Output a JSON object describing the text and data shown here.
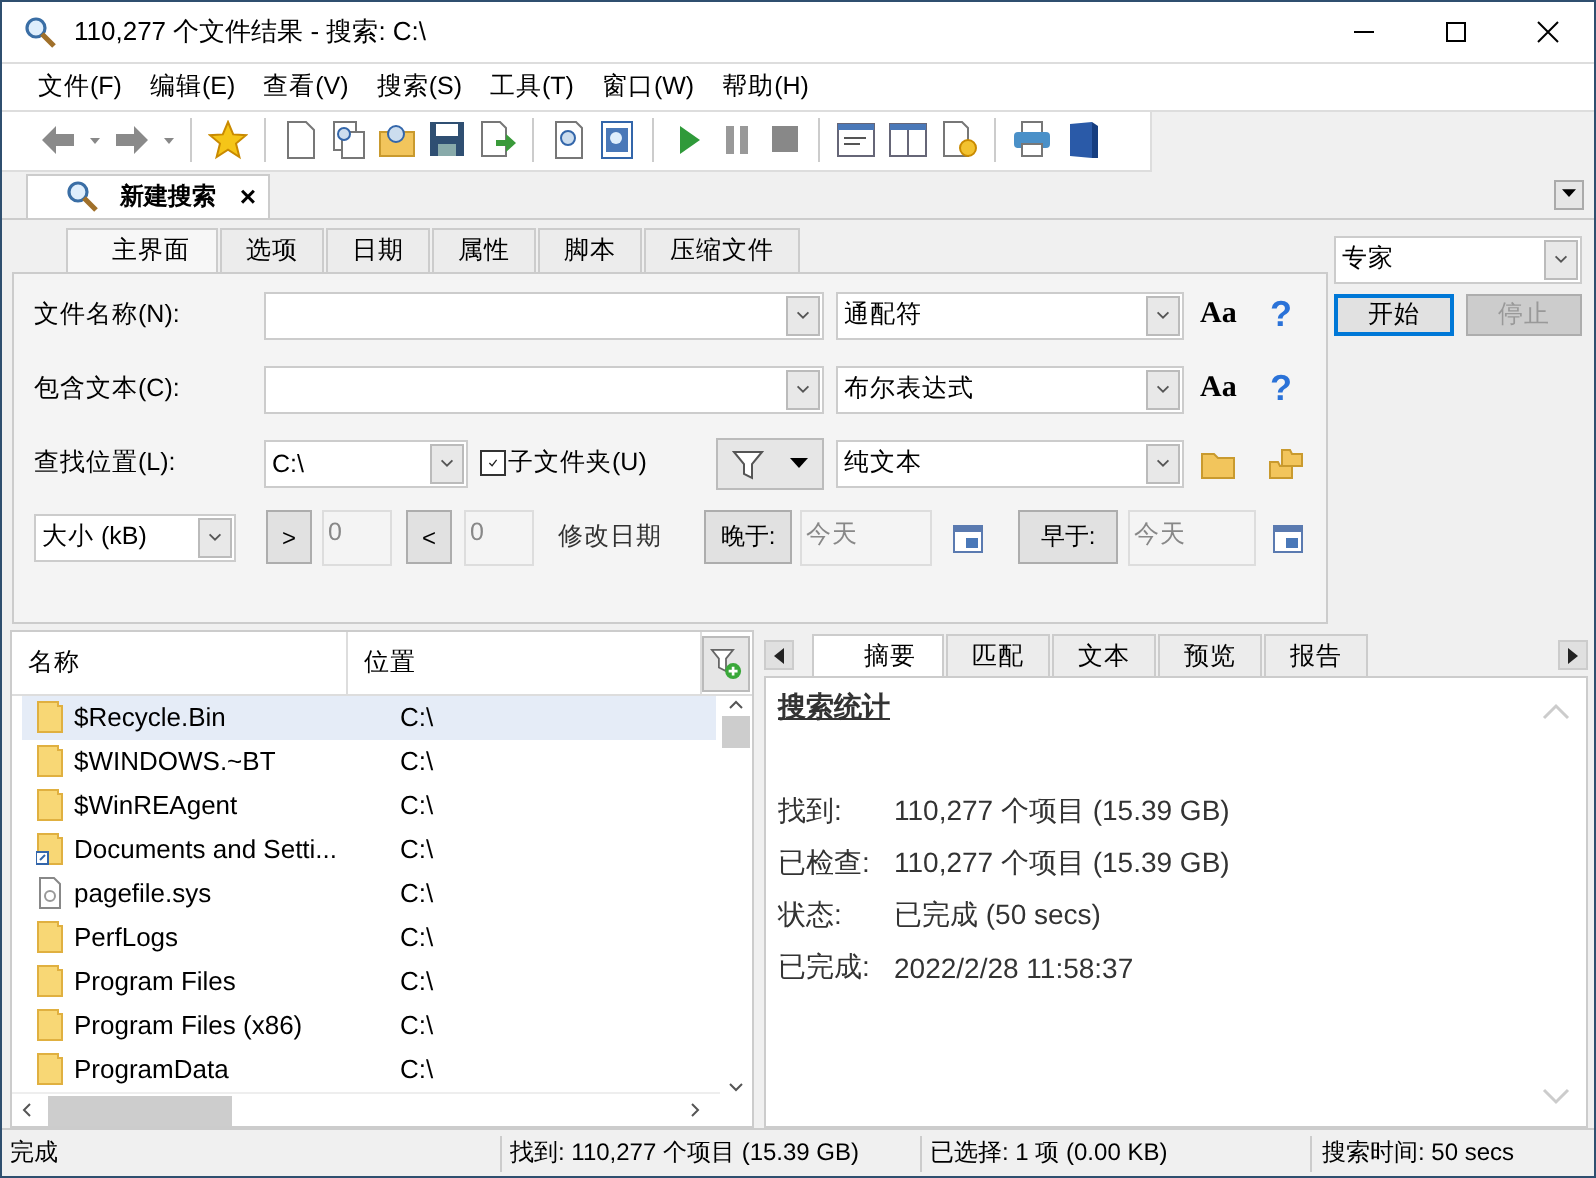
{
  "window": {
    "title": "110,277 个文件结果 - 搜索: C:\\"
  },
  "menu": [
    "文件(F)",
    "编辑(E)",
    "查看(V)",
    "搜索(S)",
    "工具(T)",
    "窗口(W)",
    "帮助(H)"
  ],
  "doc_tabs": [
    {
      "label": "新建搜索",
      "selected": true,
      "close": "×"
    }
  ],
  "search_tabs": [
    {
      "label": "主界面",
      "selected": true
    },
    {
      "label": "选项",
      "selected": false
    },
    {
      "label": "日期",
      "selected": false
    },
    {
      "label": "属性",
      "selected": false
    },
    {
      "label": "脚本",
      "selected": false
    },
    {
      "label": "压缩文件",
      "selected": false
    }
  ],
  "file_name": {
    "label": "文件名称(N):",
    "mode": "通配符",
    "case_button": "Aa",
    "help_button": "?"
  },
  "contains_text": {
    "label": "包含文本(C):",
    "mode": "布尔表达式",
    "case_button": "Aa",
    "help_button": "?"
  },
  "location": {
    "label": "查找位置(L):",
    "value": "C:\\",
    "subfolders": {
      "label": "子文件夹(U)",
      "checked": true
    },
    "mode": "纯文本"
  },
  "size": {
    "unit": "大小 (kB)",
    "greater": {
      "label": ">",
      "value": "0",
      "disabled": true
    },
    "less": {
      "label": "<",
      "value": "0",
      "disabled": true
    }
  },
  "date": {
    "label": "修改日期",
    "after": {
      "label": "晚于:",
      "value": "今天",
      "disabled": true
    },
    "before": {
      "label": "早于:",
      "value": "今天",
      "disabled": true
    }
  },
  "search_mode": "专家",
  "start_button": {
    "label": "开始",
    "disabled": false
  },
  "stop_button": {
    "label": "停止",
    "disabled": true
  },
  "results": {
    "columns": [
      "名称",
      "位置"
    ],
    "rows": [
      {
        "name": "$Recycle.Bin",
        "location": "C:\\",
        "kind": "folder",
        "selected": true
      },
      {
        "name": "$WINDOWS.~BT",
        "location": "C:\\",
        "kind": "folder",
        "selected": false
      },
      {
        "name": "$WinREAgent",
        "location": "C:\\",
        "kind": "folder",
        "selected": false
      },
      {
        "name": "Documents and Setti...",
        "location": "C:\\",
        "kind": "shortcut",
        "selected": false
      },
      {
        "name": "pagefile.sys",
        "location": "C:\\",
        "kind": "file",
        "selected": false
      },
      {
        "name": "PerfLogs",
        "location": "C:\\",
        "kind": "folder",
        "selected": false
      },
      {
        "name": "Program Files",
        "location": "C:\\",
        "kind": "folder",
        "selected": false
      },
      {
        "name": "Program Files (x86)",
        "location": "C:\\",
        "kind": "folder",
        "selected": false
      },
      {
        "name": "ProgramData",
        "location": "C:\\",
        "kind": "folder",
        "selected": false
      }
    ]
  },
  "details": {
    "tabs": [
      {
        "label": "摘要",
        "selected": true
      },
      {
        "label": "匹配",
        "selected": false
      },
      {
        "label": "文本",
        "selected": false
      },
      {
        "label": "预览",
        "selected": false
      },
      {
        "label": "报告",
        "selected": false
      }
    ],
    "heading": "搜索统计",
    "stats": [
      {
        "label": "找到:",
        "value": "110,277 个项目 (15.39 GB)"
      },
      {
        "label": "已检查:",
        "value": "110,277 个项目 (15.39 GB)"
      },
      {
        "label": "状态:",
        "value": "已完成 (50 secs)"
      },
      {
        "label": "已完成:",
        "value": "2022/2/28 11:58:37"
      }
    ]
  },
  "status_bar": [
    {
      "text": "完成"
    },
    {
      "text": "找到: 110,277 个项目 (15.39 GB)"
    },
    {
      "text": "已选择: 1 项 (0.00 KB)"
    },
    {
      "text": "搜索时间: 50 secs"
    }
  ]
}
